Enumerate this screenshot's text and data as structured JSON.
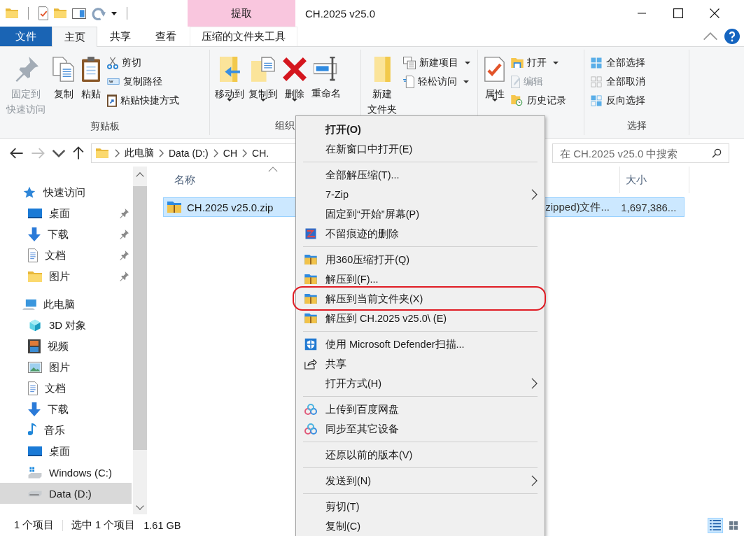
{
  "title_bar": {
    "context_tab": "提取",
    "title": "CH.2025 v25.0"
  },
  "ribbon": {
    "tabs": [
      {
        "label": "文件",
        "kind": "file",
        "selected": false
      },
      {
        "label": "主页",
        "kind": "tab",
        "selected": true
      },
      {
        "label": "共享",
        "kind": "tab",
        "selected": false
      },
      {
        "label": "查看",
        "kind": "tab",
        "selected": false
      },
      {
        "label": "压缩的文件夹工具",
        "kind": "context",
        "selected": false
      }
    ],
    "groups": [
      {
        "label": "剪贴板",
        "large": [
          {
            "lines": [
              "固定到",
              "快速访问"
            ],
            "kind": "pin",
            "disabled": true,
            "dropdown": false
          },
          {
            "lines": [
              "复制"
            ],
            "kind": "copy",
            "disabled": false,
            "dropdown": false
          },
          {
            "lines": [
              "粘贴"
            ],
            "kind": "paste",
            "disabled": false,
            "dropdown": false
          }
        ],
        "small": [
          {
            "label": "剪切",
            "kind": "cut",
            "disabled": false,
            "dropdown": false
          },
          {
            "label": "复制路径",
            "kind": "path",
            "disabled": false,
            "dropdown": false
          },
          {
            "label": "粘贴快捷方式",
            "kind": "shortcut",
            "disabled": false,
            "dropdown": false
          }
        ]
      },
      {
        "label": "组织",
        "large": [
          {
            "lines": [
              "移动到"
            ],
            "kind": "move",
            "disabled": false,
            "dropdown": true
          },
          {
            "lines": [
              "复制到"
            ],
            "kind": "copyto",
            "disabled": false,
            "dropdown": true
          },
          {
            "lines": [
              "删除"
            ],
            "kind": "delete",
            "disabled": false,
            "dropdown": true
          },
          {
            "lines": [
              "重命名"
            ],
            "kind": "rename",
            "disabled": false,
            "dropdown": false
          }
        ]
      },
      {
        "large": [
          {
            "lines": [
              "新建",
              "文件夹"
            ],
            "kind": "newfolder",
            "disabled": false,
            "dropdown": false
          }
        ],
        "small": [
          {
            "label": "新建项目",
            "kind": "newitem",
            "disabled": false,
            "dropdown": true
          },
          {
            "label": "轻松访问",
            "kind": "easy",
            "disabled": false,
            "dropdown": true
          }
        ]
      },
      {
        "large": [
          {
            "lines": [
              "属性"
            ],
            "kind": "properties",
            "disabled": false,
            "dropdown": true
          }
        ],
        "small": [
          {
            "label": "打开",
            "kind": "open",
            "disabled": false,
            "dropdown": true
          },
          {
            "label": "编辑",
            "kind": "edit",
            "disabled": true,
            "dropdown": false
          },
          {
            "label": "历史记录",
            "kind": "history",
            "disabled": false,
            "dropdown": false
          }
        ]
      },
      {
        "label": "选择",
        "small": [
          {
            "label": "全部选择",
            "kind": "selectall",
            "disabled": false,
            "dropdown": false
          },
          {
            "label": "全部取消",
            "kind": "selectnone",
            "disabled": false,
            "dropdown": false
          },
          {
            "label": "反向选择",
            "kind": "invert",
            "disabled": false,
            "dropdown": false
          }
        ]
      }
    ]
  },
  "address_bar": {
    "crumbs": [
      "此电脑",
      "Data (D:)",
      "CH",
      "CH."
    ],
    "search_placeholder": "在 CH.2025 v25.0 中搜索"
  },
  "navigation": [
    {
      "label": "快速访问",
      "kind": "star",
      "selected": false,
      "pinned": false,
      "children": [
        {
          "label": "桌面",
          "kind": "desktop",
          "selected": false,
          "pinned": true
        },
        {
          "label": "下载",
          "kind": "download",
          "selected": false,
          "pinned": true
        },
        {
          "label": "文档",
          "kind": "doc",
          "selected": false,
          "pinned": true
        },
        {
          "label": "图片",
          "kind": "folder",
          "selected": false,
          "pinned": true
        }
      ]
    },
    {
      "label": "此电脑",
      "kind": "pc",
      "selected": false,
      "pinned": false,
      "children": [
        {
          "label": "3D 对象",
          "kind": "cube",
          "selected": false,
          "pinned": false
        },
        {
          "label": "视频",
          "kind": "film",
          "selected": false,
          "pinned": false
        },
        {
          "label": "图片",
          "kind": "image",
          "selected": false,
          "pinned": false
        },
        {
          "label": "文档",
          "kind": "doc",
          "selected": false,
          "pinned": false
        },
        {
          "label": "下载",
          "kind": "download",
          "selected": false,
          "pinned": false
        },
        {
          "label": "音乐",
          "kind": "music",
          "selected": false,
          "pinned": false
        },
        {
          "label": "桌面",
          "kind": "desktop",
          "selected": false,
          "pinned": false
        },
        {
          "label": "Windows (C:)",
          "kind": "drivewin",
          "selected": false,
          "pinned": false
        },
        {
          "label": "Data (D:)",
          "kind": "drive",
          "selected": true,
          "pinned": false
        }
      ]
    }
  ],
  "file_list": {
    "columns": [
      {
        "label": "名称",
        "sorted": true
      },
      {
        "label": "大小",
        "sorted": false
      }
    ],
    "rows": [
      {
        "name": "CH.2025 v25.0.zip",
        "type": "zipped)文件...",
        "size": "1,697,386...",
        "selected": true
      }
    ]
  },
  "status_bar": {
    "count": "1 个项目",
    "selection": "选中 1 个项目",
    "size": "1.61 GB",
    "views": [
      {
        "kind": "details",
        "selected": true
      },
      {
        "kind": "icons",
        "selected": false
      }
    ]
  },
  "context_menu": [
    {
      "kind": "plain",
      "label": "打开(O)",
      "default": true,
      "submenu": false,
      "circled": false
    },
    {
      "kind": "plain",
      "label": "在新窗口中打开(E)",
      "default": false,
      "submenu": false,
      "circled": false
    },
    {
      "kind": "separator"
    },
    {
      "kind": "plain",
      "label": "全部解压缩(T)...",
      "default": false,
      "submenu": false,
      "circled": false
    },
    {
      "kind": "plain",
      "label": "7-Zip",
      "default": false,
      "submenu": true,
      "circled": false
    },
    {
      "kind": "plain",
      "label": "固定到“开始”屏幕(P)",
      "default": false,
      "submenu": false,
      "circled": false
    },
    {
      "kind": "shred",
      "label": "不留痕迹的删除",
      "default": false,
      "submenu": false,
      "circled": false
    },
    {
      "kind": "separator"
    },
    {
      "kind": "archive",
      "label": "用360压缩打开(Q)",
      "default": false,
      "submenu": false,
      "circled": false
    },
    {
      "kind": "archive",
      "label": "解压到(F)...",
      "default": false,
      "submenu": false,
      "circled": false
    },
    {
      "kind": "archive",
      "label": "解压到当前文件夹(X)",
      "default": false,
      "submenu": false,
      "circled": true
    },
    {
      "kind": "archive",
      "label": "解压到 CH.2025 v25.0\\ (E)",
      "default": false,
      "submenu": false,
      "circled": false
    },
    {
      "kind": "separator"
    },
    {
      "kind": "shield",
      "label": "使用 Microsoft Defender扫描...",
      "default": false,
      "submenu": false,
      "circled": false
    },
    {
      "kind": "share",
      "label": "共享",
      "default": false,
      "submenu": false,
      "circled": false
    },
    {
      "kind": "plain",
      "label": "打开方式(H)",
      "default": false,
      "submenu": true,
      "circled": false
    },
    {
      "kind": "separator"
    },
    {
      "kind": "cloud",
      "label": "上传到百度网盘",
      "default": false,
      "submenu": false,
      "circled": false
    },
    {
      "kind": "cloud",
      "label": "同步至其它设备",
      "default": false,
      "submenu": false,
      "circled": false
    },
    {
      "kind": "separator"
    },
    {
      "kind": "plain",
      "label": "还原以前的版本(V)",
      "default": false,
      "submenu": false,
      "circled": false
    },
    {
      "kind": "separator"
    },
    {
      "kind": "plain",
      "label": "发送到(N)",
      "default": false,
      "submenu": true,
      "circled": false
    },
    {
      "kind": "separator"
    },
    {
      "kind": "plain",
      "label": "剪切(T)",
      "default": false,
      "submenu": false,
      "circled": false
    },
    {
      "kind": "plain",
      "label": "复制(C)",
      "default": false,
      "submenu": false,
      "circled": false
    }
  ]
}
